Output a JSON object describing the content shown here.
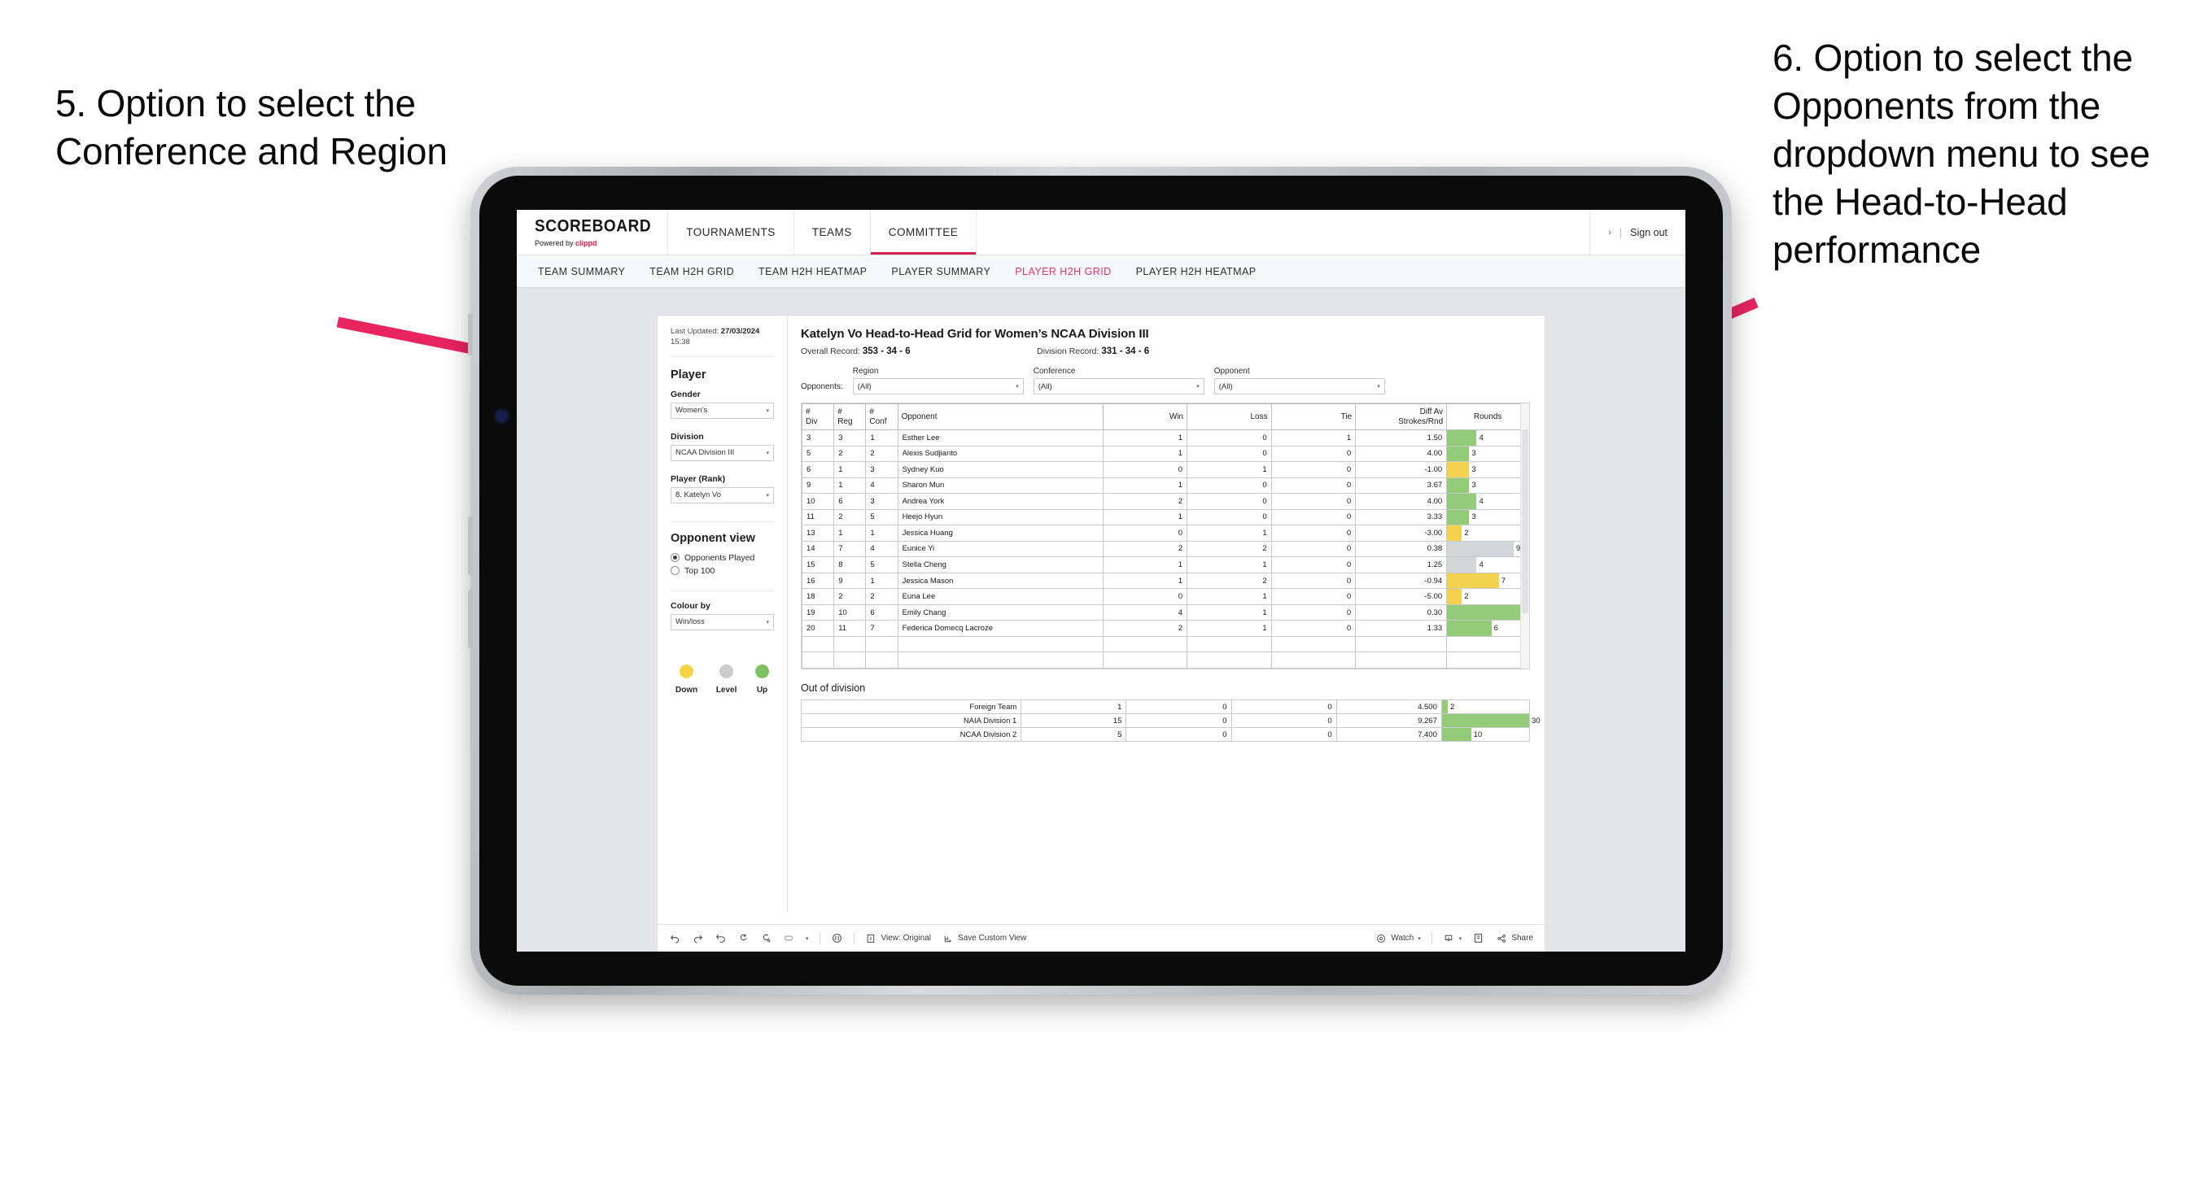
{
  "annotations": {
    "left": "5. Option to select the Conference and Region",
    "right": "6. Option to select the Opponents from the dropdown menu to see the Head-to-Head performance",
    "arrow_color": "#E8255F"
  },
  "topnav": {
    "brand_title": "SCOREBOARD",
    "brand_sub_prefix": "Powered by ",
    "brand_mark": "clippd",
    "items": [
      {
        "label": "TOURNAMENTS",
        "active": false
      },
      {
        "label": "TEAMS",
        "active": false
      },
      {
        "label": "COMMITTEE",
        "active": true
      }
    ],
    "chevron": "›",
    "separator": "|",
    "sign_out": "Sign out"
  },
  "subnav": {
    "items": [
      {
        "label": "TEAM SUMMARY",
        "active": false
      },
      {
        "label": "TEAM H2H GRID",
        "active": false
      },
      {
        "label": "TEAM H2H HEATMAP",
        "active": false
      },
      {
        "label": "PLAYER SUMMARY",
        "active": false
      },
      {
        "label": "PLAYER H2H GRID",
        "active": true
      },
      {
        "label": "PLAYER H2H HEATMAP",
        "active": false
      }
    ]
  },
  "sidebar": {
    "last_updated_label": "Last Updated:",
    "last_updated_value": "27/03/2024",
    "last_updated_time": "15:38",
    "player_heading": "Player",
    "gender_label": "Gender",
    "gender_value": "Women’s",
    "division_label": "Division",
    "division_value": "NCAA Division III",
    "player_rank_label": "Player (Rank)",
    "player_rank_value": "8. Katelyn Vo",
    "opponent_view_heading": "Opponent view",
    "opponent_view_options": [
      {
        "label": "Opponents Played",
        "selected": true
      },
      {
        "label": "Top 100",
        "selected": false
      }
    ],
    "colour_by_label": "Colour by",
    "colour_by_value": "Win/loss",
    "legend": [
      {
        "label": "Down",
        "color": "#F5D547"
      },
      {
        "label": "Level",
        "color": "#C8CBD0"
      },
      {
        "label": "Up",
        "color": "#7DC365"
      }
    ],
    "caret": "▾"
  },
  "main": {
    "title": "Katelyn Vo Head-to-Head Grid for Women’s NCAA Division III",
    "overall_record_label": "Overall Record:",
    "overall_record_value": "353 - 34 - 6",
    "division_record_label": "Division Record:",
    "division_record_value": "331 - 34 - 6",
    "filters_label": "Opponents:",
    "filters": [
      {
        "label": "Region",
        "value": "(All)"
      },
      {
        "label": "Conference",
        "value": "(All)"
      },
      {
        "label": "Opponent",
        "value": "(All)"
      }
    ],
    "out_of_division_title": "Out of division"
  },
  "chart_data": {
    "type": "table",
    "title": "Katelyn Vo Head-to-Head Grid for Women’s NCAA Division III",
    "columns": [
      "# Div",
      "# Reg",
      "# Conf",
      "Opponent",
      "Win",
      "Loss",
      "Tie",
      "Diff Av Strokes/Rnd",
      "Rounds"
    ],
    "column_headers_split": [
      {
        "l1": "#",
        "l2": "Div"
      },
      {
        "l1": "#",
        "l2": "Reg"
      },
      {
        "l1": "#",
        "l2": "Conf"
      },
      {
        "l1": "Opponent",
        "l2": ""
      },
      {
        "l1": "Win",
        "l2": ""
      },
      {
        "l1": "Loss",
        "l2": ""
      },
      {
        "l1": "Tie",
        "l2": ""
      },
      {
        "l1": "Diff Av",
        "l2": "Strokes/Rnd"
      },
      {
        "l1": "Rounds",
        "l2": ""
      }
    ],
    "rounds_max": 11,
    "rows": [
      {
        "div": "3",
        "reg": "3",
        "conf": "1",
        "opponent": "Esther Lee",
        "win": "1",
        "loss": "0",
        "tie": "1",
        "diff": "1.50",
        "rounds": "4",
        "color": "green"
      },
      {
        "div": "5",
        "reg": "2",
        "conf": "2",
        "opponent": "Alexis Sudjianto",
        "win": "1",
        "loss": "0",
        "tie": "0",
        "diff": "4.00",
        "rounds": "3",
        "color": "green"
      },
      {
        "div": "6",
        "reg": "1",
        "conf": "3",
        "opponent": "Sydney Kuo",
        "win": "0",
        "loss": "1",
        "tie": "0",
        "diff": "-1.00",
        "rounds": "3",
        "color": "yellow"
      },
      {
        "div": "9",
        "reg": "1",
        "conf": "4",
        "opponent": "Sharon Mun",
        "win": "1",
        "loss": "0",
        "tie": "0",
        "diff": "3.67",
        "rounds": "3",
        "color": "green"
      },
      {
        "div": "10",
        "reg": "6",
        "conf": "3",
        "opponent": "Andrea York",
        "win": "2",
        "loss": "0",
        "tie": "0",
        "diff": "4.00",
        "rounds": "4",
        "color": "green"
      },
      {
        "div": "11",
        "reg": "2",
        "conf": "5",
        "opponent": "Heejo Hyun",
        "win": "1",
        "loss": "0",
        "tie": "0",
        "diff": "3.33",
        "rounds": "3",
        "color": "green"
      },
      {
        "div": "13",
        "reg": "1",
        "conf": "1",
        "opponent": "Jessica Huang",
        "win": "0",
        "loss": "1",
        "tie": "0",
        "diff": "-3.00",
        "rounds": "2",
        "color": "yellow"
      },
      {
        "div": "14",
        "reg": "7",
        "conf": "4",
        "opponent": "Eunice Yi",
        "win": "2",
        "loss": "2",
        "tie": "0",
        "diff": "0.38",
        "rounds": "9",
        "color": "grey",
        "diff_color": "green"
      },
      {
        "div": "15",
        "reg": "8",
        "conf": "5",
        "opponent": "Stella Cheng",
        "win": "1",
        "loss": "1",
        "tie": "0",
        "diff": "1.25",
        "rounds": "4",
        "color": "grey",
        "diff_color": "green"
      },
      {
        "div": "16",
        "reg": "9",
        "conf": "1",
        "opponent": "Jessica Mason",
        "win": "1",
        "loss": "2",
        "tie": "0",
        "diff": "-0.94",
        "rounds": "7",
        "color": "yellow"
      },
      {
        "div": "18",
        "reg": "2",
        "conf": "2",
        "opponent": "Euna Lee",
        "win": "0",
        "loss": "1",
        "tie": "0",
        "diff": "-5.00",
        "rounds": "2",
        "color": "yellow"
      },
      {
        "div": "19",
        "reg": "10",
        "conf": "6",
        "opponent": "Emily Chang",
        "win": "4",
        "loss": "1",
        "tie": "0",
        "diff": "0.30",
        "rounds": "11",
        "color": "green"
      },
      {
        "div": "20",
        "reg": "11",
        "conf": "7",
        "opponent": "Federica Domecq Lacroze",
        "win": "2",
        "loss": "1",
        "tie": "0",
        "diff": "1.33",
        "rounds": "6",
        "color": "green"
      }
    ],
    "out_of_division": {
      "rounds_max": 30,
      "rows": [
        {
          "name": "Foreign Team",
          "win": "1",
          "loss": "0",
          "tie": "0",
          "diff": "4.500",
          "rounds": "2",
          "color": "green"
        },
        {
          "name": "NAIA Division 1",
          "win": "15",
          "loss": "0",
          "tie": "0",
          "diff": "9.267",
          "rounds": "30",
          "color": "green"
        },
        {
          "name": "NCAA Division 2",
          "win": "5",
          "loss": "0",
          "tie": "0",
          "diff": "7.400",
          "rounds": "10",
          "color": "green"
        }
      ]
    }
  },
  "toolbar": {
    "view_label": "View: Original",
    "save_label": "Save Custom View",
    "watch_label": "Watch",
    "share_label": "Share",
    "caret": "▾"
  }
}
